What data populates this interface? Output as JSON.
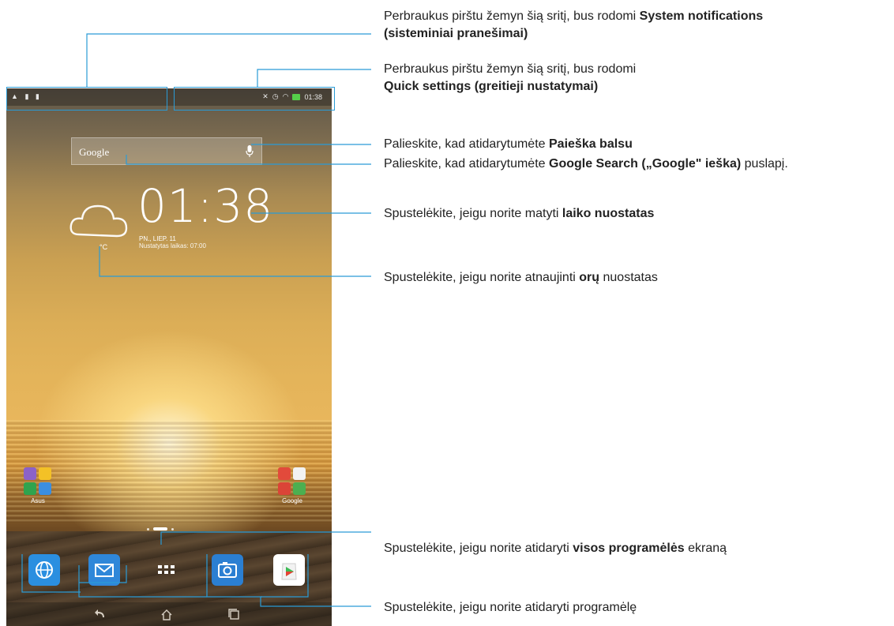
{
  "status_bar": {
    "time": "01:38",
    "left_icons": [
      "warning-icon",
      "sim-icon",
      "sd-card-icon"
    ],
    "right_icons": [
      "mute-icon",
      "alarm-icon",
      "wifi-icon",
      "battery-icon"
    ]
  },
  "search_widget": {
    "label": "Google"
  },
  "clock_widget": {
    "time": "01:38",
    "date": "PN., LIEP. 11",
    "alarm": "Nustatytas laikas: 07:00"
  },
  "weather_widget": {
    "temperature_unit": "°C"
  },
  "folders": [
    {
      "label": "Asus",
      "colors": [
        "#8b62c8",
        "#f3c126",
        "#2fa44e",
        "#3b8ee0"
      ]
    },
    {
      "label": "Google",
      "colors": [
        "#e24a3b",
        "#f2f2f2",
        "#db4437",
        "#4caf50"
      ]
    }
  ],
  "dock": {
    "apps": [
      {
        "name": "browser",
        "color": "#2b8fe0"
      },
      {
        "name": "email",
        "color": "#2f87d9"
      },
      {
        "name": "all-apps",
        "color": ""
      },
      {
        "name": "camera",
        "color": "#2b7fd2"
      },
      {
        "name": "play-store",
        "color": "#ffffff"
      }
    ]
  },
  "annotations": {
    "system_notifications": {
      "prefix": "Perbraukus pirštu žemyn šią sritį, bus rodomi ",
      "bold1": "System notifications",
      "bold2": "(sisteminiai pranešimai)"
    },
    "quick_settings": {
      "line1": "Perbraukus pirštu žemyn šią sritį, bus rodomi",
      "bold": "Quick settings (greitieji nustatymai)"
    },
    "voice_search": {
      "prefix": "Palieskite, kad atidarytumėte ",
      "bold": "Paieška balsu"
    },
    "google_search": {
      "prefix": "Palieskite, kad atidarytumėte ",
      "bold": "Google Search („Google\" ieška)",
      "suffix": " puslapį."
    },
    "time_settings": {
      "prefix": "Spustelėkite, jeigu norite matyti ",
      "bold": "laiko nuostatas"
    },
    "weather_update": {
      "prefix": "Spustelėkite, jeigu norite atnaujinti ",
      "bold": "orų",
      "suffix": " nuostatas"
    },
    "all_apps": {
      "prefix": "Spustelėkite, jeigu norite atidaryti ",
      "bold": "visos programėlės",
      "suffix": " ekraną"
    },
    "open_app": {
      "text": "Spustelėkite, jeigu norite atidaryti programėlę"
    }
  },
  "colors": {
    "callout_line": "#2a9bd6",
    "sunset_sky": "#e4b45a"
  }
}
